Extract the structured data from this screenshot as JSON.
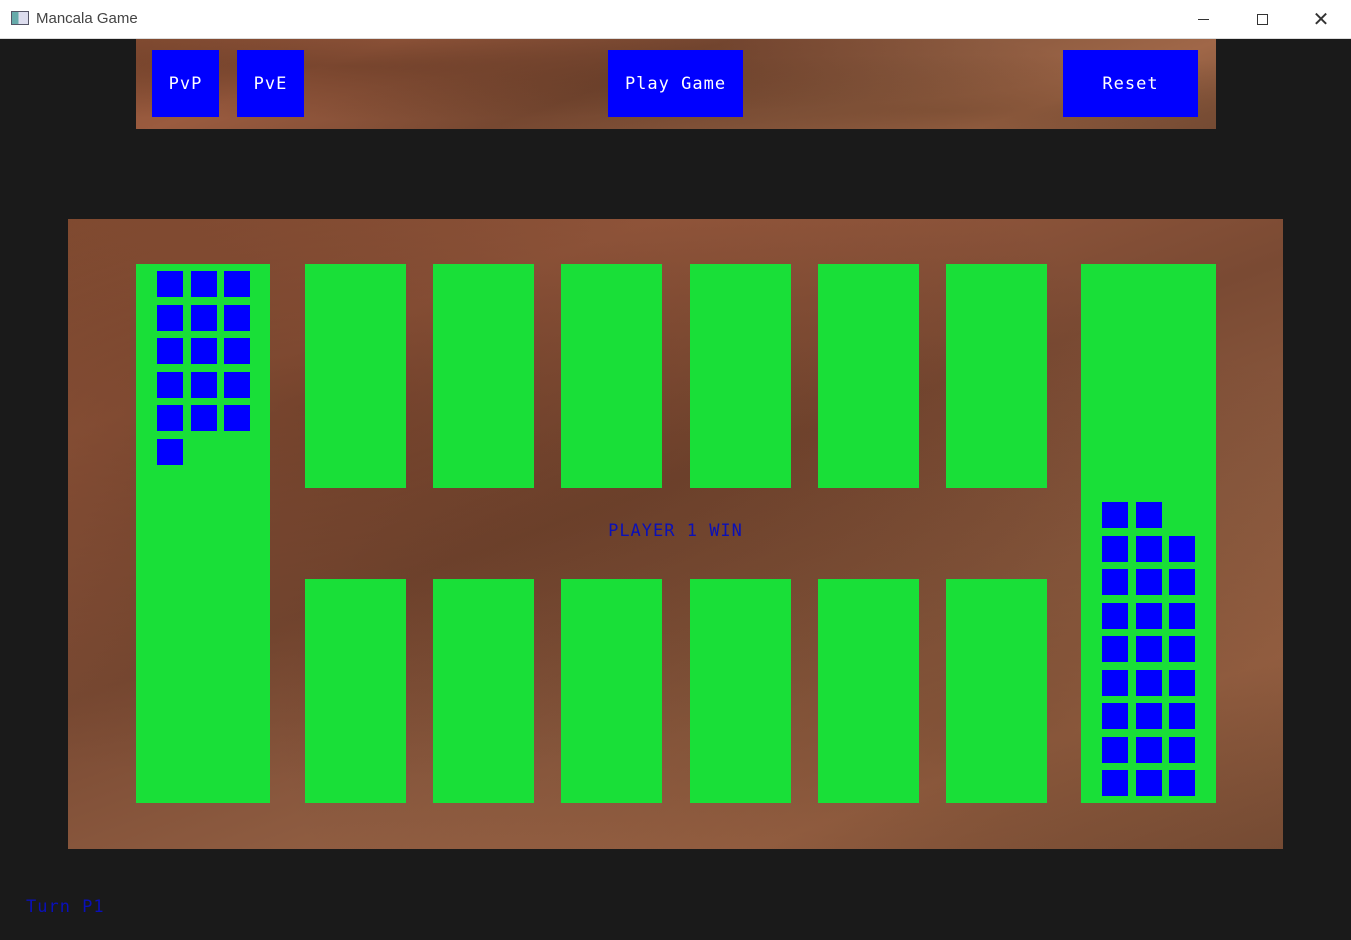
{
  "window": {
    "title": "Mancala Game",
    "controls": {
      "minimize": "minimize",
      "maximize": "maximize",
      "close": "✕"
    }
  },
  "toolbar": {
    "pvp_label": "PvP",
    "pve_label": "PvE",
    "play_label": "Play Game",
    "reset_label": "Reset"
  },
  "board": {
    "status_text": "PLAYER 1 WIN",
    "left_store_stones": 16,
    "right_store_stones": 26,
    "top_pits_stones": [
      0,
      0,
      0,
      0,
      0,
      0
    ],
    "bottom_pits_stones": [
      0,
      0,
      0,
      0,
      0,
      0
    ]
  },
  "turn_text": "Turn P1",
  "colors": {
    "background": "#1a1a1a",
    "pit": "#19df38",
    "stone": "#0000ff",
    "button": "#0000ff",
    "status_text": "#0a10b8"
  }
}
